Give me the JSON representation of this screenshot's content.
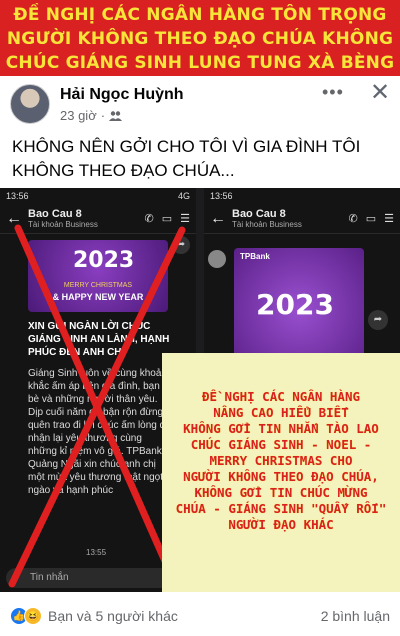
{
  "banner": {
    "line1": "ĐỀ NGHỊ CÁC NGÂN HÀNG TÔN TRỌNG",
    "line2": "NGƯỜI KHÔNG THEO ĐẠO CHÚA KHÔNG",
    "line3": "CHÚC GIÁNG SINH LUNG TUNG XÀ BÈNG"
  },
  "post": {
    "author": "Hải Ngọc Huỳnh",
    "time": "23 giờ",
    "dot": "·",
    "more_icon": "•••",
    "close_icon": "✕",
    "text": "KHÔNG NÊN GỞI CHO TÔI VÌ GIA ĐÌNH TÔI KHÔNG THEO ĐẠO CHÚA..."
  },
  "left_phone": {
    "status_time": "13:56",
    "status_right": "4G",
    "chat_name": "Bao Cau 8",
    "chat_sub": "Tài khoản Business",
    "card_year": "2023",
    "card_line1": "MERRY CHRISTMAS",
    "card_line2": "& HAPPY NEW YEAR",
    "msg_bold": "XIN GỬI NGÀN LỜI CHÚC GIÁNG SINH AN LÀNH, HẠNH PHÚC ĐẾN ANH CHỊ",
    "msg_body": "Giáng Sinh luôn về cùng khoảnh khắc ấm áp bên gia đình, bạn bè và những người thân yêu. Dịp cuối năm dù bận rộn đừng quên trao đi lời chúc ấm lòng để nhận lại yêu thương cùng những kỉ niệm vô giá. TPBank Quảng Ngãi xin chúc anh chị một mùa yêu thương thật ngọt ngào và hạnh phúc",
    "chat_time": "13:55",
    "input_placeholder": "Tin nhắn"
  },
  "right_phone": {
    "status_time": "13:56",
    "chat_name": "Bao Cau 8",
    "chat_sub": "Tài khoản Business",
    "bank_logo": "TPBank",
    "card_year": "2023"
  },
  "overlay": {
    "lines": [
      "ĐỀ NGHỊ CÁC NGÂN HÀNG",
      "NÂNG CAO HIỂU BIẾT",
      "KHÔNG GỞI TIN NHẮN TÀO LAO",
      "CHÚC GIÁNG SINH - NOEL -",
      "MERRY CHRISTMAS CHO",
      "NGƯỜI KHÔNG THEO ĐẠO CHÚA,",
      "KHÔNG GỞI TIN CHÚC MỪNG",
      "CHÚA - GIÁNG SINH \"QUẤY RỐI\"",
      "NGƯỜI ĐẠO KHÁC"
    ]
  },
  "footer": {
    "reactions_text": "Bạn và 5 người khác",
    "comments_text": "2 bình luận"
  },
  "colors": {
    "banner_bg": "#d92122",
    "banner_text": "#f7e53a",
    "overlay_bg": "#f5f3bd",
    "overlay_text": "#d92122",
    "x_mark": "#e02020"
  }
}
